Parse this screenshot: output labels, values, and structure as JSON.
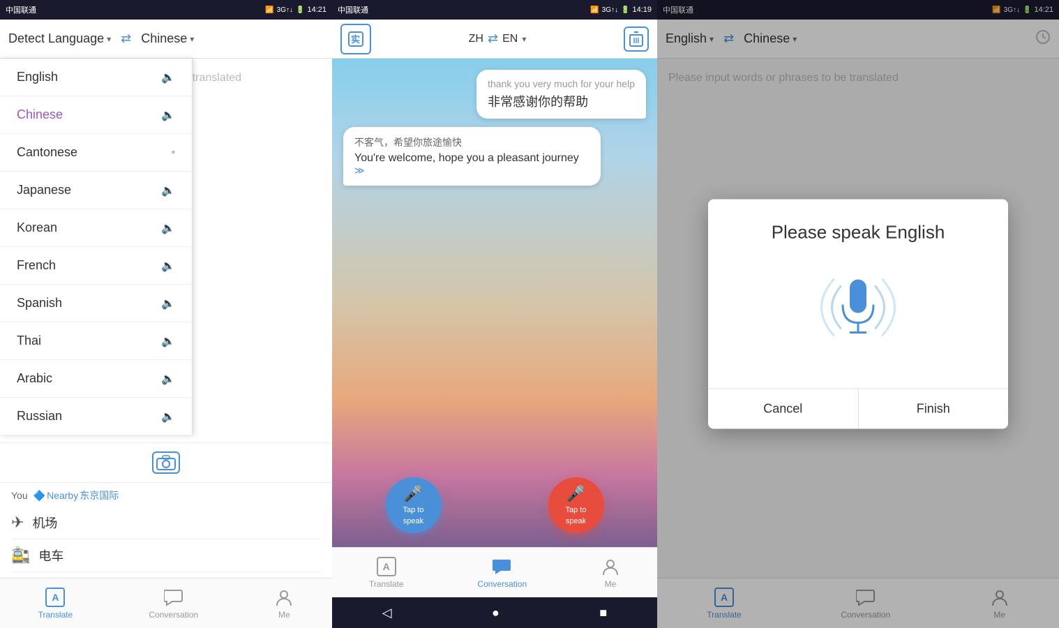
{
  "screens": {
    "left": {
      "statusBar": {
        "carrier": "中国联通",
        "time": "14:21",
        "signal": "3G↑↓"
      },
      "topBar": {
        "sourceLanguage": "Detect Language",
        "targetLanguage": "Chinese"
      },
      "inputPlaceholder": "Please input words or phrases to be translated",
      "nearbyLabel": "You",
      "nearbyLinkLabel": "Nearby",
      "nearbyLocation": "东京国际",
      "nearbyItems": [
        {
          "icon": "✈",
          "text": "机场"
        },
        {
          "icon": "🚉",
          "text": "电车"
        }
      ],
      "dropdown": {
        "items": [
          {
            "label": "English",
            "active": false
          },
          {
            "label": "Chinese",
            "active": true
          },
          {
            "label": "Cantonese",
            "active": false
          },
          {
            "label": "Japanese",
            "active": false
          },
          {
            "label": "Korean",
            "active": false
          },
          {
            "label": "French",
            "active": false
          },
          {
            "label": "Spanish",
            "active": false
          },
          {
            "label": "Thai",
            "active": false
          },
          {
            "label": "Arabic",
            "active": false
          },
          {
            "label": "Russian",
            "active": false
          }
        ]
      },
      "tabs": [
        {
          "id": "translate",
          "label": "Translate",
          "active": true
        },
        {
          "id": "conversation",
          "label": "Conversation",
          "active": false
        },
        {
          "id": "me",
          "label": "Me",
          "active": false
        }
      ]
    },
    "middle": {
      "statusBar": {
        "carrier": "中国联通",
        "time": "14:19",
        "signal": "3G↑↓"
      },
      "header": {
        "leftLang": "ZH",
        "rightLang": "EN",
        "swapLabel": "⇄"
      },
      "messages": [
        {
          "side": "right",
          "textEn": "thank you very much for your help",
          "textZh": "非常感谢你的帮助"
        },
        {
          "side": "left",
          "textZh": "不客气，希望你旅途愉快",
          "textEn": "You're welcome, hope you a pleasant journey"
        }
      ],
      "speakBtns": [
        {
          "label": "Tap to speak",
          "color": "blue"
        },
        {
          "label": "Tap to speak",
          "color": "red"
        }
      ],
      "tabs": [
        {
          "id": "translate",
          "label": "Translate",
          "active": false
        },
        {
          "id": "conversation",
          "label": "Conversation",
          "active": true
        },
        {
          "id": "me",
          "label": "Me",
          "active": false
        }
      ],
      "navBtns": [
        "◁",
        "●",
        "■"
      ]
    },
    "right": {
      "statusBar": {
        "carrier": "中国联通",
        "time": "14:21",
        "signal": "3G↑↓"
      },
      "topBar": {
        "sourceLanguage": "English",
        "targetLanguage": "Chinese"
      },
      "inputPlaceholder": "Please input words or phrases to be translated",
      "dialog": {
        "title": "Please speak English",
        "cancelLabel": "Cancel",
        "finishLabel": "Finish"
      },
      "tabs": [
        {
          "id": "translate",
          "label": "Translate",
          "active": true
        },
        {
          "id": "conversation",
          "label": "Conversation",
          "active": false
        },
        {
          "id": "me",
          "label": "Me",
          "active": false
        }
      ]
    }
  }
}
